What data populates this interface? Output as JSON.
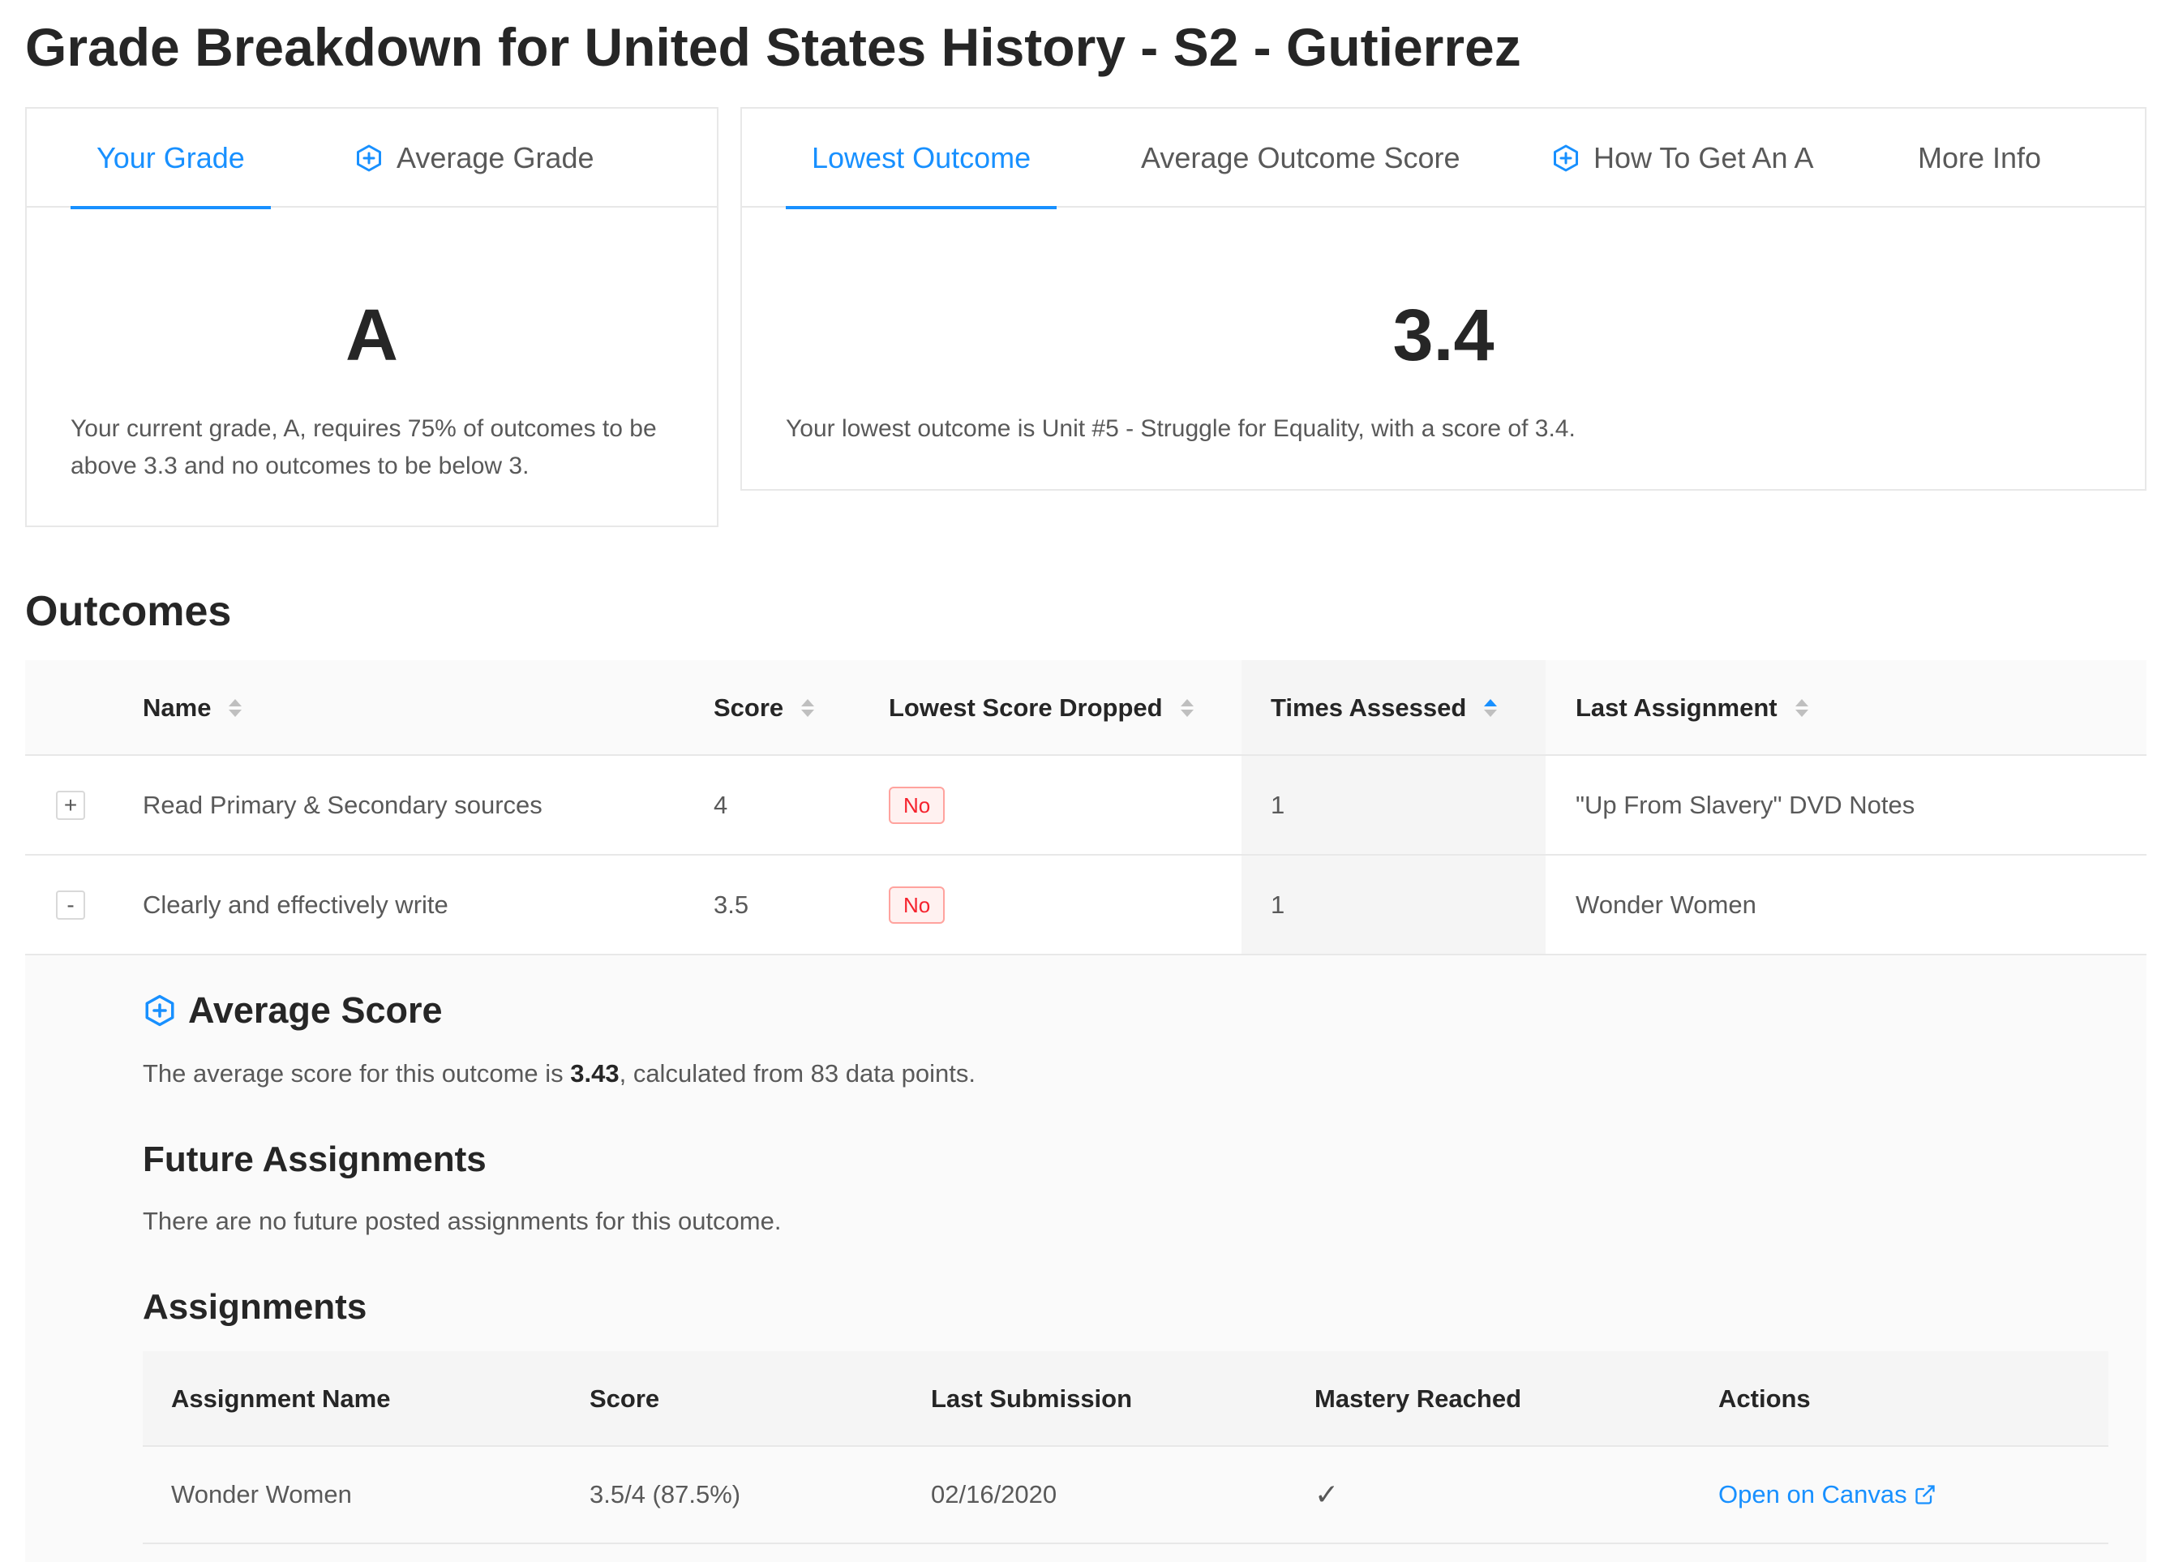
{
  "page": {
    "title": "Grade Breakdown for United States History - S2 - Gutierrez"
  },
  "colors": {
    "accent": "#1890ff",
    "danger": "#f5222d",
    "text": "#595959",
    "heading": "#262626"
  },
  "grade_card": {
    "tabs": [
      {
        "label": "Your Grade",
        "active": true,
        "icon": null
      },
      {
        "label": "Average Grade",
        "active": false,
        "icon": "plus-hexagon-icon"
      }
    ],
    "value": "A",
    "description": "Your current grade, A, requires 75% of outcomes to be above 3.3 and no outcomes to be below 3."
  },
  "outcome_card": {
    "tabs": [
      {
        "label": "Lowest Outcome",
        "active": true,
        "icon": null
      },
      {
        "label": "Average Outcome Score",
        "active": false,
        "icon": null
      },
      {
        "label": "How To Get An A",
        "active": false,
        "icon": "plus-hexagon-icon"
      },
      {
        "label": "More Info",
        "active": false,
        "icon": null
      }
    ],
    "value": "3.4",
    "description": "Your lowest outcome is Unit #5 - Struggle for Equality, with a score of 3.4."
  },
  "outcomes": {
    "title": "Outcomes",
    "columns": [
      "Name",
      "Score",
      "Lowest Score Dropped",
      "Times Assessed",
      "Last Assignment"
    ],
    "sorted_column": "Times Assessed",
    "sort_direction": "ascending",
    "rows": [
      {
        "expand": "+",
        "name": "Read Primary & Secondary sources",
        "score": "4",
        "dropped": "No",
        "times": "1",
        "last": "\"Up From Slavery\" DVD Notes"
      },
      {
        "expand": "-",
        "name": "Clearly and effectively write",
        "score": "3.5",
        "dropped": "No",
        "times": "1",
        "last": "Wonder Women"
      }
    ]
  },
  "expanded": {
    "avg_title": "Average Score",
    "avg_icon": "plus-hexagon-icon",
    "avg_pre": "The average score for this outcome is ",
    "avg_value": "3.43",
    "avg_post": ", calculated from 83 data points.",
    "future_title": "Future Assignments",
    "future_text": "There are no future posted assignments for this outcome.",
    "assign_title": "Assignments",
    "assign_columns": [
      "Assignment Name",
      "Score",
      "Last Submission",
      "Mastery Reached",
      "Actions"
    ],
    "assign_rows": [
      {
        "name": "Wonder Women",
        "score": "3.5/4 (87.5%)",
        "date": "02/16/2020",
        "mastery": "✓",
        "action": "Open on Canvas",
        "action_icon": "external-link-icon"
      }
    ]
  }
}
